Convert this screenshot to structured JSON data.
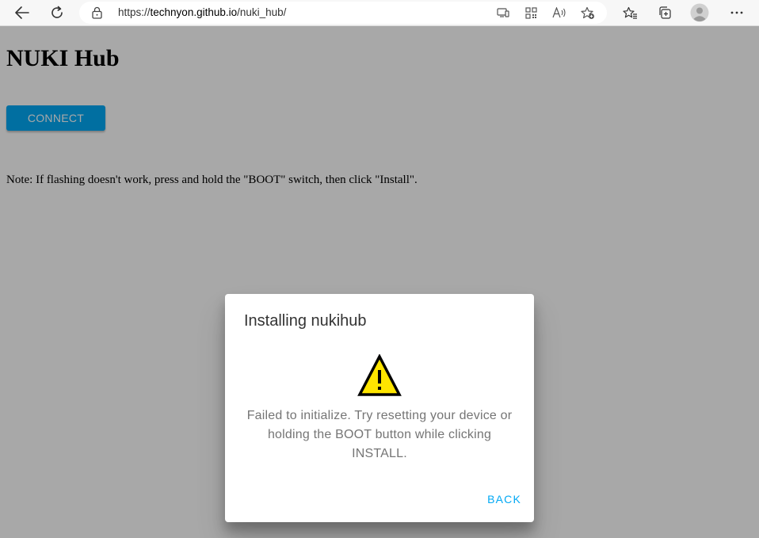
{
  "browser": {
    "url_scheme": "https://",
    "url_host": "technyon.github.io",
    "url_path": "/nuki_hub/"
  },
  "page": {
    "title": "NUKI Hub",
    "connect_label": "CONNECT",
    "note": "Note: If flashing doesn't work, press and hold the \"BOOT\" switch, then click \"Install\"."
  },
  "dialog": {
    "title": "Installing nukihub",
    "message": "Failed to initialize. Try resetting your device or holding the BOOT button while clicking INSTALL.",
    "back_label": "BACK",
    "icon": "warning-icon"
  },
  "colors": {
    "accent": "#03a9f4",
    "warning_fill": "#ffe500",
    "message_text": "#757575"
  }
}
